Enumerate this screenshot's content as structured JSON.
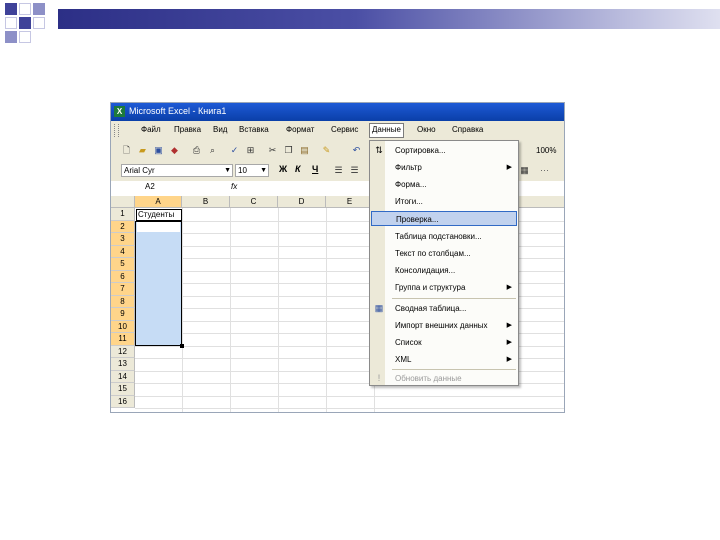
{
  "window": {
    "title": "Microsoft Excel - Книга1",
    "app_icon": "X"
  },
  "menubar": {
    "items": [
      "Файл",
      "Правка",
      "Вид",
      "Вставка",
      "Формат",
      "Сервис",
      "Данные",
      "Окно",
      "Справка"
    ],
    "active": "Данные"
  },
  "toolbar": {
    "zoom": "100%",
    "font_name": "Arial Cyr",
    "font_size": "10",
    "bold": "Ж",
    "italic": "К",
    "underline": "Ч"
  },
  "formula_bar": {
    "name_box": "A2",
    "fx": "fx"
  },
  "sheet": {
    "columns": [
      "A",
      "B",
      "C",
      "D",
      "E"
    ],
    "rows": [
      "1",
      "2",
      "3",
      "4",
      "5",
      "6",
      "7",
      "8",
      "9",
      "10",
      "11",
      "12",
      "13",
      "14",
      "15",
      "16"
    ],
    "cell_A1": "Студенты"
  },
  "data_menu": {
    "items": [
      {
        "label": "Сортировка...",
        "icon": "sort-az-icon"
      },
      {
        "label": "Фильтр",
        "submenu": true
      },
      {
        "label": "Форма..."
      },
      {
        "label": "Итоги..."
      },
      {
        "label": "Проверка...",
        "highlighted": true
      },
      {
        "label": "Таблица подстановки..."
      },
      {
        "label": "Текст по столбцам..."
      },
      {
        "label": "Консолидация..."
      },
      {
        "label": "Группа и структура",
        "submenu": true
      },
      {
        "label": "Сводная таблица...",
        "icon": "pivot-table-icon"
      },
      {
        "label": "Импорт внешних данных",
        "submenu": true
      },
      {
        "label": "Список",
        "submenu": true
      },
      {
        "label": "XML",
        "submenu": true
      },
      {
        "label": "Обновить данные",
        "disabled": true,
        "icon": "refresh-icon"
      }
    ]
  },
  "colors": {
    "title_bar": "#0a3fa8",
    "selection": "#c6dcf5",
    "highlight": "#c1d2ee",
    "slide_bar": "#2c2f86"
  }
}
